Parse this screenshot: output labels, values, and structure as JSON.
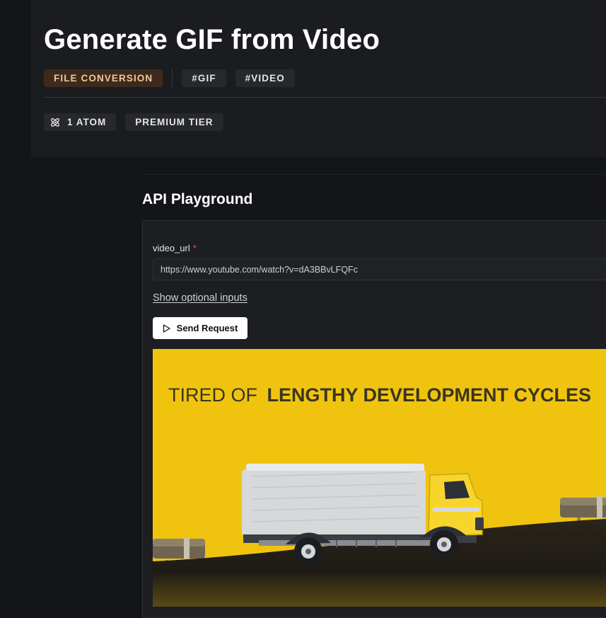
{
  "header": {
    "title": "Generate GIF from Video",
    "category_tag": "FILE CONVERSION",
    "tags": [
      "#GIF",
      "#VIDEO"
    ],
    "atom_count_label": "1 ATOM",
    "tier_label": "PREMIUM TIER"
  },
  "playground": {
    "section_title": "API Playground",
    "field_label": "video_url",
    "required_marker": "*",
    "video_url_value": "https://www.youtube.com/watch?v=dA3BBvLFQFc",
    "optional_inputs_link": "Show optional inputs",
    "send_button_label": "Send Request"
  },
  "preview": {
    "caption_light": "TIRED OF",
    "caption_bold": "LENGTHY DEVELOPMENT CYCLES"
  },
  "colors": {
    "page_bg": "#131518",
    "panel_bg": "#1a1c20",
    "category_tag_bg": "#3e2a1d",
    "category_tag_text": "#f0c69a",
    "preview_yellow": "#f0c40e",
    "required_red": "#e05252"
  },
  "icons": {
    "atom": "atom-icon",
    "send": "play-icon"
  }
}
